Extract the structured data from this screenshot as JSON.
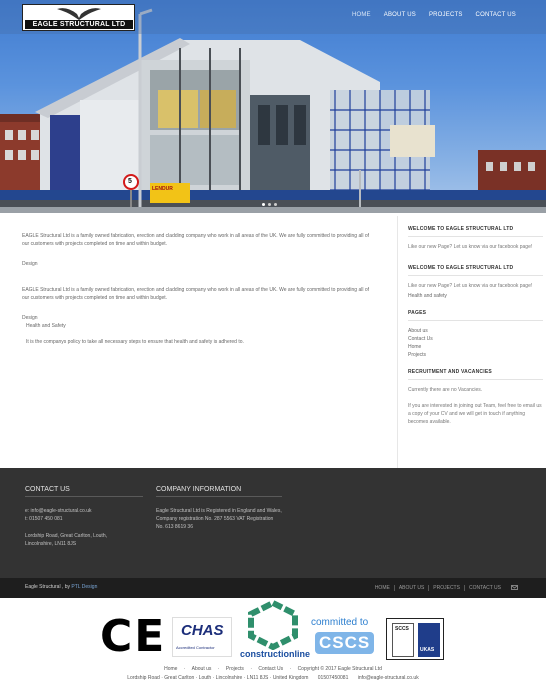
{
  "header": {
    "logo_text": "EAGLE STRUCTURAL LTD",
    "nav": [
      "HOME",
      "ABOUT US",
      "PROJECTS",
      "CONTACT US"
    ],
    "hero_sign": "5",
    "hero_banner": "LENDUR"
  },
  "main": {
    "intro_1": "EAGLE Structural Ltd is a family owned fabrication, erection and cladding company who work in all areas of the UK. We are fully committed to providing all of our customers with projects completed on time and within budget.",
    "design_1": "Design",
    "intro_2": "EAGLE Structural Ltd is a family owned fabrication, erection and cladding company who work in all areas of the UK. We are fully committed to providing all of our customers with projects completed on time and within budget.",
    "design_2": "Design",
    "hs_title": "Health and Safety",
    "hs_text": "It is the companys policy to take all necessary steps to ensure that health and safety is adhered to."
  },
  "sidebar": {
    "welcome_1_title": "WELCOME TO EAGLE STRUCTURAL LTD",
    "welcome_1_text": "Like our new Page? Let us know via our facebook page!",
    "welcome_2_title": "WELCOME TO EAGLE STRUCTURAL LTD",
    "welcome_2_text": "Like our new Page? Let us know via our facebook page!",
    "hs_link": "Health and safety",
    "pages_title": "PAGES",
    "pages": [
      "About us",
      "Contact Us",
      "Home",
      "Projects"
    ],
    "recruit_title": "RECRUITMENT AND VACANCIES",
    "recruit_1": "Currently there are no Vacancies.",
    "recruit_2": "If you are interested in joining out Team, feel free to email us a copy of your CV and we will get in touch if anything becomes available."
  },
  "footer": {
    "contact_title": "CONTACT US",
    "email": "e: info@eagle-structural.co.uk",
    "tel": "t: 01507 450 081",
    "address_1": "Lordship Road, Great Carlton, Louth,",
    "address_2": "Lincolnshire, LN11 8JS",
    "company_title": "COMPANY INFORMATION",
    "company_text": "Eagle Structural Ltd is Registered in England and Wales, Company registration No. 287 5563 VAT Registration No. 613 8619 36",
    "copy_prefix": "Eagle Structural , by",
    "copy_by": "PTL Design",
    "bottom_nav": [
      "HOME",
      "ABOUT US",
      "PROJECTS",
      "CONTACT US"
    ]
  },
  "accreditations": {
    "ce": "CE",
    "chas": "CHAS",
    "chas_sub": "Accredited Contractor",
    "constructionline": "constructionline",
    "cscs_top": "committed to",
    "cscs": "CSCS",
    "sccs": "SCCS",
    "ukas": "UKAS"
  },
  "bottom_links": {
    "items": [
      "Home",
      "About us",
      "Projects",
      "Contact Us"
    ],
    "copyright": "Copyright © 2017 Eagle Structural Ltd",
    "address": "Lordship Road · Great Carlton · Louth · Lincolnshire · LN11 8JS · United Kingdom",
    "phone": "01507450081",
    "email": "info@eagle-structural.co.uk"
  }
}
